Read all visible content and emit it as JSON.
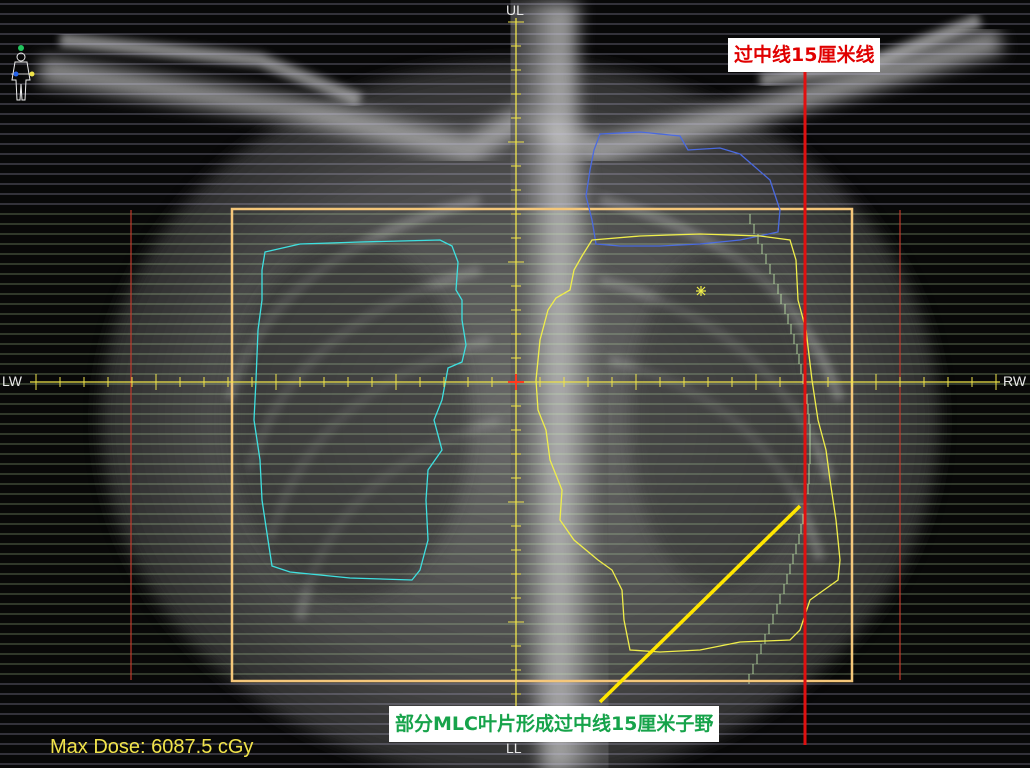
{
  "orientation": {
    "top": "UL",
    "bottom": "LL",
    "left": "LW",
    "right": "RW"
  },
  "annotations": {
    "midline_line": "过中线15厘米线",
    "subfield_note": "部分MLC叶片形成过中线15厘米子野"
  },
  "dose": {
    "max_dose_label": "Max Dose: 6087.5 cGy"
  },
  "colors": {
    "field_border": "#f5c77a",
    "mlc_leaf_lines": "#c8f0b0",
    "leaf_bank_stripes": "#c9c4ea",
    "target_contour": "#f0ee4a",
    "left_lung_contour": "#3ee0e0",
    "upper_contour": "#4a6ae0",
    "midline_marker": "#e01010",
    "pointer_line": "#ffe600",
    "axis_color": "#f0e44a",
    "isocenter": "#ff3b1f",
    "annotation_red": "#e00000",
    "annotation_green": "#16a34a"
  },
  "icons": {
    "orientation_widget": "patient-orientation-icon"
  }
}
